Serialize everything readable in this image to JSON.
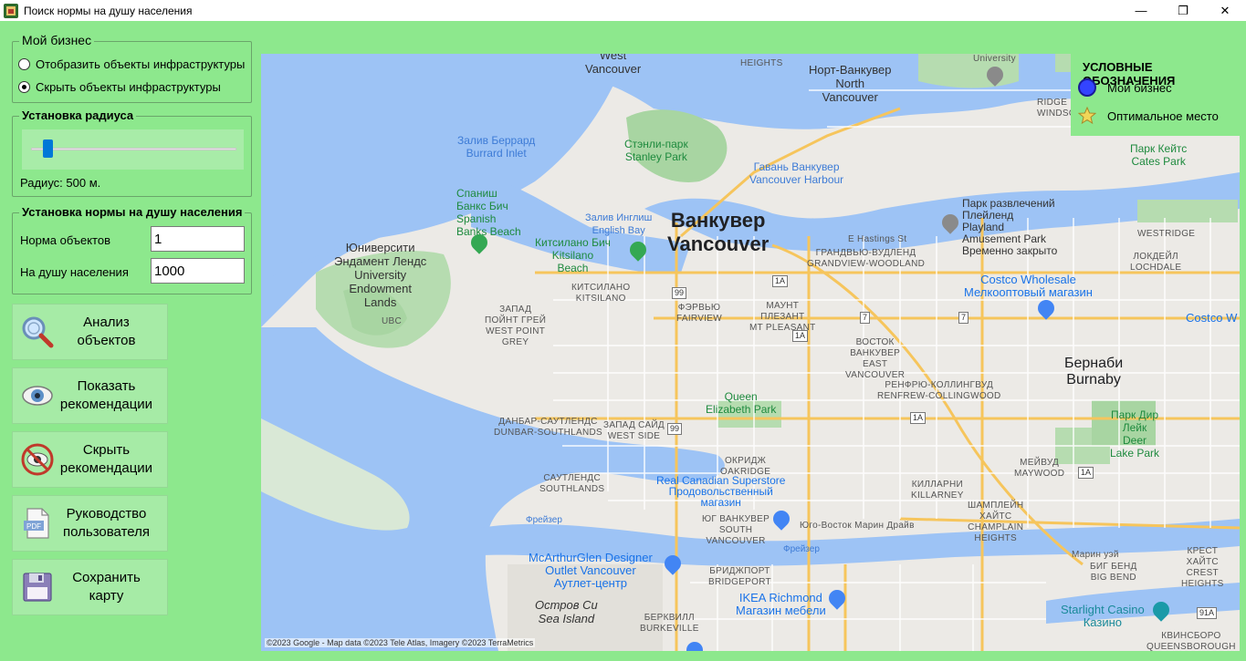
{
  "window": {
    "title": "Поиск нормы на душу населения",
    "minimize": "—",
    "restore": "❐",
    "close": "✕"
  },
  "my_business": {
    "title": "Мой бизнес",
    "options": [
      {
        "label": "Отобразить объекты инфраструктуры",
        "checked": false
      },
      {
        "label": "Скрыть объекты инфраструктуры",
        "checked": true
      }
    ]
  },
  "radius": {
    "title": "Установка радиуса",
    "value_text": "Радиус: 500 м.",
    "slider_fraction": 0.06
  },
  "norm": {
    "title": "Установка нормы на душу населения",
    "objects_label": "Норма объектов",
    "objects_value": "1",
    "population_label": "На душу населения",
    "population_value": "1000"
  },
  "actions": [
    {
      "label": "Анализ\nобъектов",
      "icon": "magnifier-icon"
    },
    {
      "label": "Показать\nрекомендации",
      "icon": "eye-icon"
    },
    {
      "label": "Скрыть\nрекомендации",
      "icon": "eye-crossed-icon"
    },
    {
      "label": "Руководство\nпользователя",
      "icon": "pdf-icon"
    },
    {
      "label": "Сохранить\nкарту",
      "icon": "floppy-icon"
    }
  ],
  "legend": {
    "title": "УСЛОВНЫЕ ОБОЗНАЧЕНИЯ",
    "my_business": "Мой бизнес",
    "optimal": "Оптимальное место",
    "business_color": "#3344ff",
    "optimal_color": "#e8c53a"
  },
  "map": {
    "copyright": "©2023 Google - Map data ©2023 Tele Atlas, Imagery ©2023 TerraMetrics",
    "labels": {
      "west_vancouver": "West\nVancouver",
      "heights": "HEIGHTS",
      "north_vancouver": "Норт-Ванкувер\nNorth\nVancouver",
      "university": "University",
      "windsor": "RIDGE\nWINDSO",
      "burrard": "Залив Беррард\nBurrard Inlet",
      "stanley": "Стэнли-парк\nStanley Park",
      "harbour": "Гавань Ванкувер\nVancouver Harbour",
      "park_keits": "Парк Кейтс\nCates Park",
      "spanish": "Спаниш\nБанкс Бич\nSpanish\nBanks Beach",
      "english": "Залив Инглиш\nEnglish Bay",
      "kitsilano_beach": "Китсилано Бич\nKitsilano\nBeach",
      "vancouver": "Ванкувер\nVancouver",
      "hastings": "E Hastings St",
      "grandview": "ГРАНДВЬЮ-ВУДЛЕНД\nGRANDVIEW-WOODLAND",
      "playland": "Парк развлечений\nПлейленд\nPlayland\nAmusement Park\nВременно закрыто",
      "westridge": "WESTRIDGE",
      "lochdale": "ЛОКДЕЙЛ\nLOCHDALE",
      "costco": "Costco Wholesale\nМелкооптовый магазин",
      "costco_w": "Costco W",
      "ubc_univ": "Юниверсити\nЭндамент Лендс\nUniversity\nEndowment\nLands",
      "kitsilano": "КИТСИЛАНО\nKITSILANO",
      "fairview": "ФЭРВЬЮ\nFAIRVIEW",
      "mt_pleasant": "МАУНТ\nПЛЕЗАНТ\nMT PLEASANT",
      "ubc": "UBC",
      "west_point_grey": "ЗАПАД\nПОЙНТ ГРЕЙ\nWEST POINT\nGREY",
      "east_vancouver": "ВОСТОК\nВАНКУВЕР\nEAST\nVANCOUVER",
      "burnaby": "Бернаби\nBurnaby",
      "renfrew": "РЕНФРЮ-КОЛЛИНГВУД\nRENFREW-COLLINGWOOD",
      "queen_elizabeth": "Queen\nElizabeth Park",
      "deer_lake": "Парк Дир\nЛейк\nDeer\nLake Park",
      "dunbar": "ДАНБАР-САУТЛЕНДС\nDUNBAR-SOUTHLANDS",
      "west_side": "ЗАПАД САЙД\nWEST SIDE",
      "oakridge": "ОКРИДЖ\nOAKRIDGE",
      "maywood": "МЕЙВУД\nMAYWOOD",
      "superstore": "Real Canadian Superstore\nПродовольственный\nмагазин",
      "southlands": "САУТЛЕНДС\nSOUTHLANDS",
      "killarney": "КИЛЛАРНИ\nKILLARNEY",
      "champlain": "ШАМПЛЕЙН\nХАЙТС\nCHAMPLAIN\nHEIGHTS",
      "fraser": "Фрейзер",
      "south_vancouver": "ЮГ ВАНКУВЕР\nSOUTH\nVANCOUVER",
      "se_marine": "Юго-Восток Марин Драйв",
      "marine_way": "Марин уэй",
      "big_bend": "БИГ БЕНД\nBIG BEND",
      "crest_heights": "КРЕСТ\nХАЙТС\nCREST\nHEIGHTS",
      "mcarthur": "McArthurGlen Designer\nOutlet Vancouver\nАутлет-центр",
      "bridgeport": "БРИДЖПОРТ\nBRIDGEPORT",
      "ikea": "IKEA Richmond\nМагазин мебели",
      "sea_island": "Остров Си\nSea Island",
      "burkeville": "БЕРКВИЛЛ\nBURKEVILLE",
      "starlight": "Starlight Casino\nКазино",
      "queensborough": "КВИНСБОРО\nQUEENSBOROUGH",
      "fraser2": "Фрейзер",
      "fraser3": "Фрейзер"
    }
  }
}
